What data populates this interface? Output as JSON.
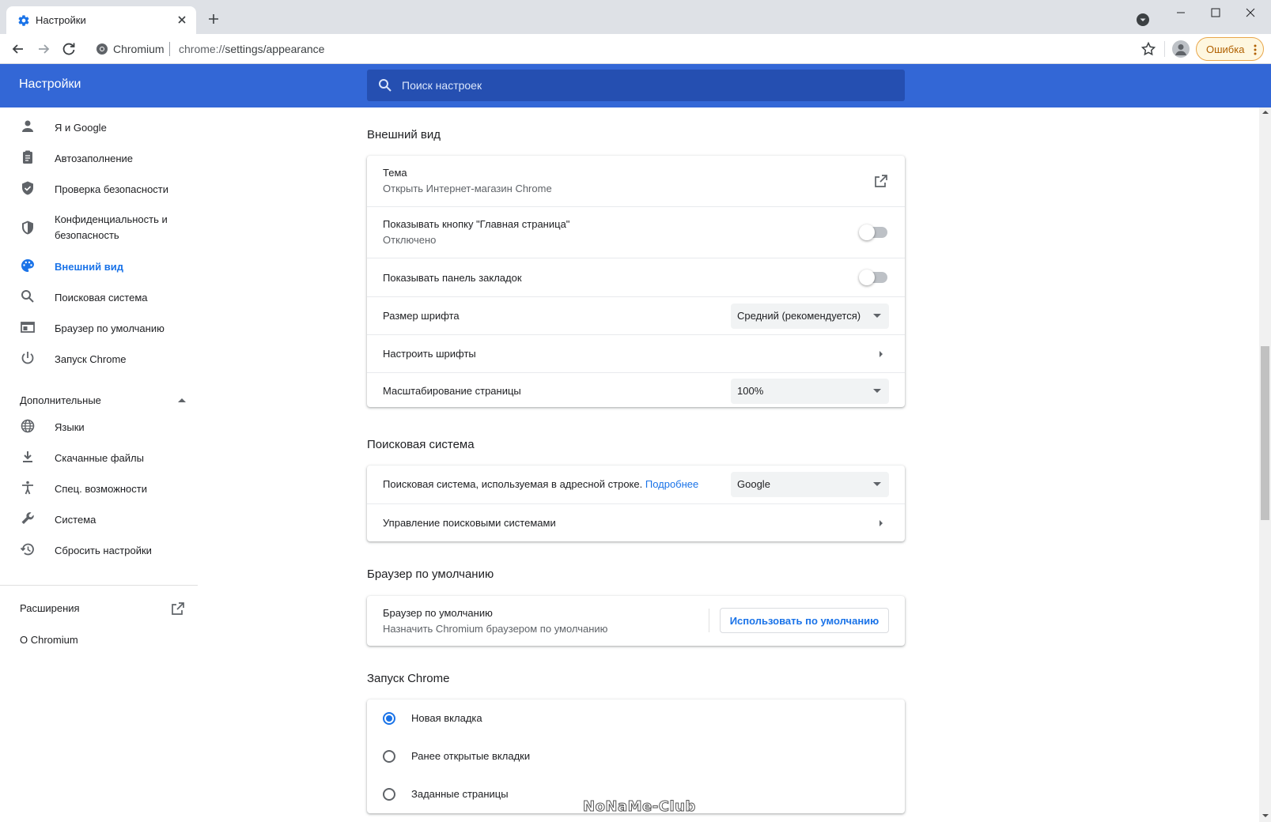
{
  "browser": {
    "tab_title": "Настройки",
    "omnibox_chip": "Chromium",
    "url_scheme": "chrome://",
    "url_path": "settings/appearance",
    "error_label": "Ошибка"
  },
  "header": {
    "title": "Настройки",
    "search_placeholder": "Поиск настроек"
  },
  "sidebar": {
    "items": [
      {
        "label": "Я и Google",
        "icon": "person-icon"
      },
      {
        "label": "Автозаполнение",
        "icon": "clipboard-icon"
      },
      {
        "label": "Проверка безопасности",
        "icon": "shield-check-icon"
      },
      {
        "label": "Конфиденциальность и безопасность",
        "icon": "shield-icon"
      },
      {
        "label": "Внешний вид",
        "icon": "palette-icon",
        "active": true
      },
      {
        "label": "Поисковая система",
        "icon": "search-icon"
      },
      {
        "label": "Браузер по умолчанию",
        "icon": "browser-icon"
      },
      {
        "label": "Запуск Chrome",
        "icon": "power-icon"
      }
    ],
    "advanced_label": "Дополнительные",
    "advanced_items": [
      {
        "label": "Языки",
        "icon": "globe-icon"
      },
      {
        "label": "Скачанные файлы",
        "icon": "download-icon"
      },
      {
        "label": "Спец. возможности",
        "icon": "accessibility-icon"
      },
      {
        "label": "Система",
        "icon": "wrench-icon"
      },
      {
        "label": "Сбросить настройки",
        "icon": "history-icon"
      }
    ],
    "extensions_label": "Расширения",
    "about_label": "О Chromium"
  },
  "appearance": {
    "section_title": "Внешний вид",
    "theme_title": "Тема",
    "theme_sub": "Открыть Интернет-магазин Chrome",
    "home_button_title": "Показывать кнопку \"Главная страница\"",
    "home_button_sub": "Отключено",
    "home_button_on": false,
    "bookmarks_bar_title": "Показывать панель закладок",
    "bookmarks_bar_on": false,
    "font_size_title": "Размер шрифта",
    "font_size_value": "Средний (рекомендуется)",
    "customize_fonts_title": "Настроить шрифты",
    "zoom_title": "Масштабирование страницы",
    "zoom_value": "100%"
  },
  "search_engine": {
    "section_title": "Поисковая система",
    "engine_title": "Поисковая система, используемая в адресной строке.",
    "engine_link": "Подробнее",
    "engine_value": "Google",
    "manage_title": "Управление поисковыми системами"
  },
  "default_browser": {
    "section_title": "Браузер по умолчанию",
    "title": "Браузер по умолчанию",
    "sub": "Назначить Chromium браузером по умолчанию",
    "button_label": "Использовать по умолчанию"
  },
  "startup": {
    "section_title": "Запуск Chrome",
    "options": [
      {
        "label": "Новая вкладка",
        "selected": true
      },
      {
        "label": "Ранее открытые вкладки",
        "selected": false
      },
      {
        "label": "Заданные страницы",
        "selected": false
      }
    ]
  },
  "watermark": "NoNaMe-Club",
  "colors": {
    "accent": "#1a73e8",
    "header_bg": "#3367d6",
    "search_bg": "#254fb1"
  }
}
